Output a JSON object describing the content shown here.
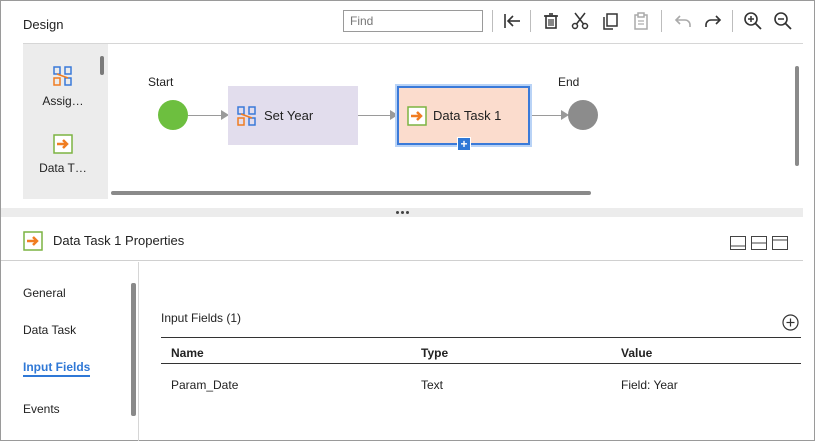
{
  "design": {
    "title": "Design",
    "find_placeholder": "Find",
    "toolbar": {
      "first": "first-icon",
      "delete": "trash-icon",
      "cut": "scissors-icon",
      "copy": "copy-icon",
      "paste": "clipboard-icon",
      "undo": "undo-icon",
      "redo": "redo-icon",
      "zoom_in": "zoom-in-icon",
      "zoom_out": "zoom-out-icon"
    },
    "palette": [
      {
        "label": "Assig…",
        "icon": "assignment-icon"
      },
      {
        "label": "Data T…",
        "icon": "data-task-icon"
      }
    ]
  },
  "canvas": {
    "start_label": "Start",
    "end_label": "End",
    "steps": [
      {
        "label": "Set Year",
        "icon": "assignment-icon"
      },
      {
        "label": "Data Task 1",
        "icon": "data-task-icon",
        "selected": true
      }
    ]
  },
  "properties": {
    "title": "Data Task 1 Properties",
    "nav": [
      {
        "label": "General"
      },
      {
        "label": "Data Task"
      },
      {
        "label": "Input Fields",
        "active": true
      },
      {
        "label": "Events"
      }
    ],
    "section_title": "Input Fields (1)",
    "columns": [
      "Name",
      "Type",
      "Value"
    ],
    "rows": [
      {
        "name": "Param_Date",
        "type": "Text",
        "value": "Field: Year"
      }
    ]
  },
  "colors": {
    "accent": "#2f78d6",
    "start": "#6dbf3f",
    "end": "#8c8c8c",
    "assignment_bg": "#e2dded",
    "task_bg": "#fbdccd",
    "task_icon": "#f07d22"
  }
}
